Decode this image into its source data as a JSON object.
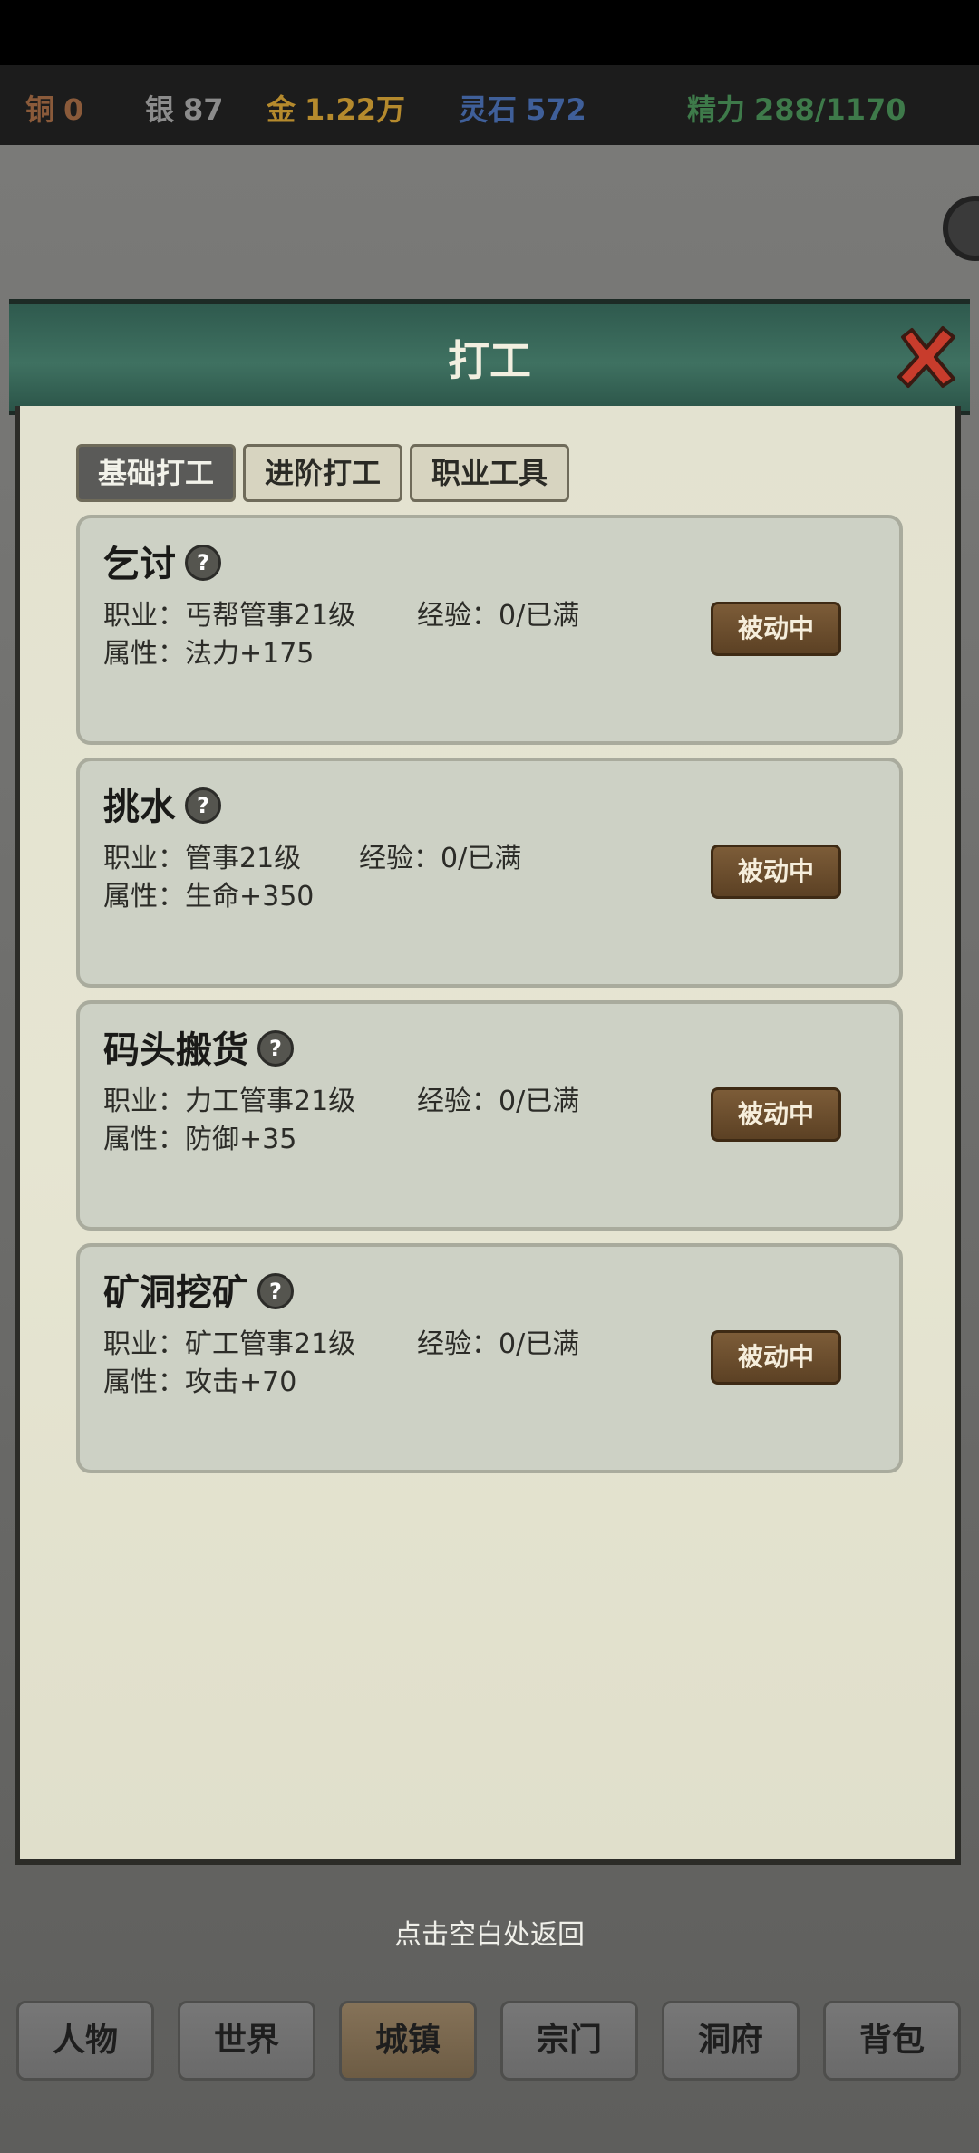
{
  "resources": [
    {
      "label": "铜",
      "value": "0",
      "color": "#8a5a3a"
    },
    {
      "label": "银",
      "value": "87",
      "color": "#8b8b8b"
    },
    {
      "label": "金",
      "value": "1.22万",
      "color": "#b58a2d"
    },
    {
      "label": "灵石",
      "value": "572",
      "color": "#3f5f99"
    },
    {
      "label": "精力",
      "value": "288/1170",
      "color": "#3e7a4a"
    }
  ],
  "dialog": {
    "title": "打工"
  },
  "tabs": [
    {
      "label": "基础打工",
      "active": true
    },
    {
      "label": "进阶打工",
      "active": false
    },
    {
      "label": "职业工具",
      "active": false
    }
  ],
  "jobs": [
    {
      "name": "乞讨",
      "profession": "职业：丐帮管事21级",
      "exp": "经验：0/已满",
      "attr": "属性：法力+175",
      "button": "被动中"
    },
    {
      "name": "挑水",
      "profession": "职业：管事21级",
      "exp": "经验：0/已满",
      "attr": "属性：生命+350",
      "button": "被动中"
    },
    {
      "name": "码头搬货",
      "profession": "职业：力工管事21级",
      "exp": "经验：0/已满",
      "attr": "属性：防御+35",
      "button": "被动中"
    },
    {
      "name": "矿洞挖矿",
      "profession": "职业：矿工管事21级",
      "exp": "经验：0/已满",
      "attr": "属性：攻击+70",
      "button": "被动中"
    }
  ],
  "hint": "点击空白处返回",
  "nav": [
    {
      "label": "人物",
      "active": false
    },
    {
      "label": "世界",
      "active": false
    },
    {
      "label": "城镇",
      "active": true
    },
    {
      "label": "宗门",
      "active": false
    },
    {
      "label": "洞府",
      "active": false
    },
    {
      "label": "背包",
      "active": false
    }
  ]
}
